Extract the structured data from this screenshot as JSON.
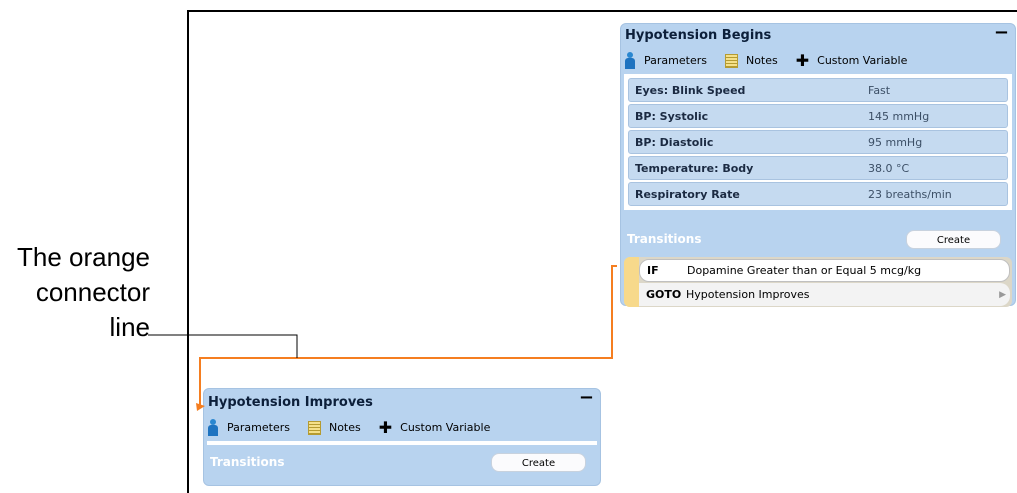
{
  "annotation": {
    "lines": [
      "The orange",
      "connector",
      "line"
    ]
  },
  "colors": {
    "connector": "#f57e20",
    "callout": "#000000",
    "node_bg": "#b8d3ef",
    "transition_bar": "#f7d98b"
  },
  "states": [
    {
      "title": "Hypotension Begins",
      "collapse": "−",
      "toolbar": {
        "parameters": "Parameters",
        "notes": "Notes",
        "custom_variable": "Custom Variable"
      },
      "parameters": [
        {
          "name": "Eyes: Blink Speed",
          "value": "Fast"
        },
        {
          "name": "BP: Systolic",
          "value": "145 mmHg"
        },
        {
          "name": "BP: Diastolic",
          "value": "95 mmHg"
        },
        {
          "name": "Temperature: Body",
          "value": "38.0 °C"
        },
        {
          "name": "Respiratory Rate",
          "value": "23 breaths/min"
        }
      ],
      "transitions_label": "Transitions",
      "create_label": "Create",
      "transition": {
        "if_kw": "IF",
        "condition": "Dopamine Greater than or Equal 5 mcg/kg",
        "goto_kw": "GOTO",
        "target": "Hypotension Improves"
      }
    },
    {
      "title": "Hypotension Improves",
      "collapse": "−",
      "toolbar": {
        "parameters": "Parameters",
        "notes": "Notes",
        "custom_variable": "Custom Variable"
      },
      "transitions_label": "Transitions",
      "create_label": "Create"
    }
  ]
}
